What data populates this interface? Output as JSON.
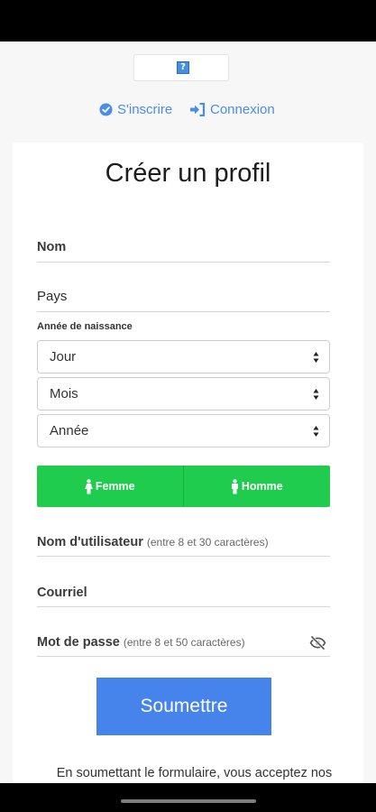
{
  "logo": {
    "alt": "?"
  },
  "auth_tabs": {
    "signup": "S'inscrire",
    "login": "Connexion"
  },
  "form": {
    "title": "Créer un profil",
    "name_label": "Nom",
    "country_label": "Pays",
    "dob_label": "Année de naissance",
    "day_placeholder": "Jour",
    "month_placeholder": "Mois",
    "year_placeholder": "Année",
    "gender_female": "Femme",
    "gender_male": "Homme",
    "username_label": "Nom d'utilisateur",
    "username_hint": "(entre 8 et 30 caractères)",
    "email_label": "Courriel",
    "password_label": "Mot de passe",
    "password_hint": "(entre 8 et 50 caractères)",
    "submit_label": "Soumettre",
    "terms_text": "En soumettant le formulaire, vous acceptez nos"
  },
  "colors": {
    "accent_blue": "#4684ec",
    "gender_green": "#1fcc4e",
    "link_blue": "#4a8de9"
  },
  "icons": {
    "signup": "check-circle-icon",
    "login": "sign-in-icon",
    "female": "female-icon",
    "male": "male-icon",
    "password_toggle": "eye-slash-icon"
  }
}
